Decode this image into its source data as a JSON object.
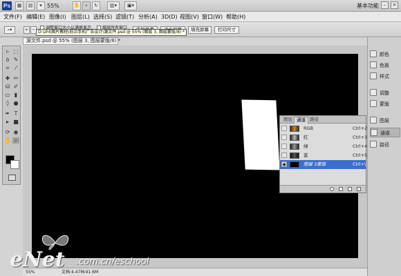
{
  "app": {
    "logo": "Ps",
    "zoom": "55%",
    "workspace": "基本功能"
  },
  "menu": [
    "文件(F)",
    "编辑(E)",
    "图像(I)",
    "图层(L)",
    "选择(S)",
    "滤镜(T)",
    "分析(A)",
    "3D(D)",
    "视图(V)",
    "窗口(W)",
    "帮助(H)"
  ],
  "options": {
    "check1": "调整窗口大小以满屏显示",
    "check2": "缩放所有窗口",
    "btn_actual": "实际像素",
    "btn_fit": "适合屏幕",
    "btn_fill": "填充屏幕",
    "btn_print": "打印尺寸",
    "path_tooltip": "D:\\zhl\\图片教程\\前沿手机广告设计\\源文件.psd @ 55% (图层 3, 图层蒙版/8) *"
  },
  "document": {
    "tab_title": "源文件.psd @ 55% (图层 3, 图层蒙版/8) *"
  },
  "status": {
    "zoom": "55%",
    "doc_size": "文档:4.47M/41.6M"
  },
  "dock": [
    "颜色",
    "色板",
    "样式",
    "调整",
    "蒙版",
    "图层",
    "通道",
    "路径"
  ],
  "channels": {
    "tabs": [
      "图层",
      "通道",
      "路径"
    ],
    "rows": [
      {
        "name": "RGB",
        "key": "Ctrl+2"
      },
      {
        "name": "红",
        "key": "Ctrl+3"
      },
      {
        "name": "绿",
        "key": "Ctrl+4"
      },
      {
        "name": "蓝",
        "key": "Ctrl+5"
      },
      {
        "name": "图层 3蒙版",
        "key": "Ctrl+\\"
      }
    ]
  },
  "watermark": {
    "brand": "eNet",
    "site": ".com.cn/eschool"
  }
}
